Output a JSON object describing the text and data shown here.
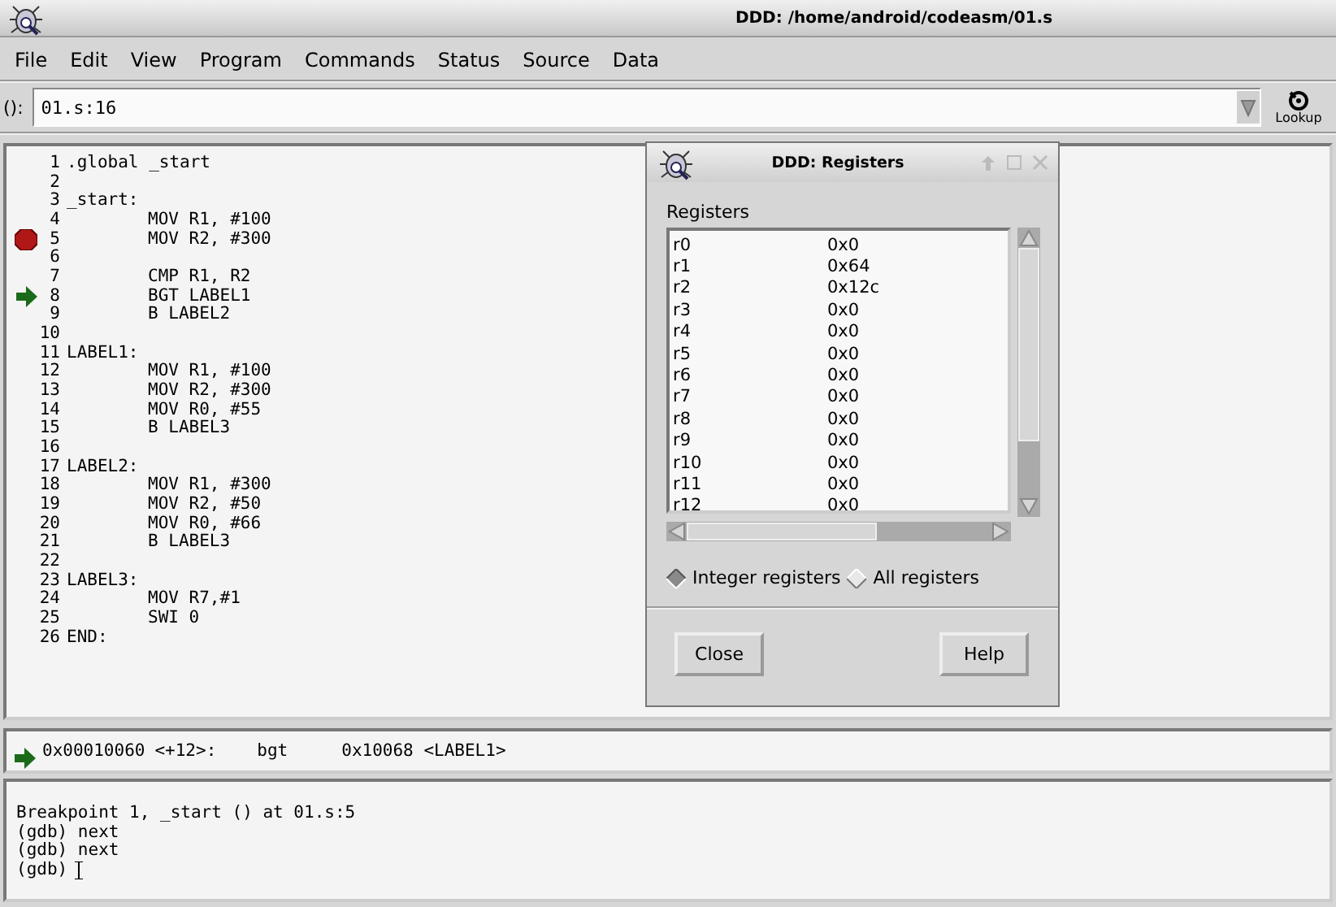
{
  "window": {
    "title": "DDD: /home/android/codeasm/01.s"
  },
  "menu": [
    "File",
    "Edit",
    "View",
    "Program",
    "Commands",
    "Status",
    "Source",
    "Data"
  ],
  "argument_field": {
    "label": "():",
    "value": "01.s:16",
    "button": "Lookup"
  },
  "source": {
    "lines": [
      {
        "number": "1",
        "kind": "label",
        "code": ".global _start",
        "breakpoint": false,
        "current": false
      },
      {
        "number": "2",
        "kind": "blank",
        "breakpoint": false,
        "current": false
      },
      {
        "number": "3",
        "kind": "label",
        "code": "_start:",
        "breakpoint": false,
        "current": false
      },
      {
        "number": "4",
        "kind": "instruction",
        "code": "MOV R1, #100",
        "breakpoint": false,
        "current": false
      },
      {
        "number": "5",
        "kind": "instruction",
        "code": "MOV R2, #300",
        "breakpoint": true,
        "current": false
      },
      {
        "number": "6",
        "kind": "blank",
        "breakpoint": false,
        "current": false
      },
      {
        "number": "7",
        "kind": "instruction",
        "code": "CMP R1, R2",
        "breakpoint": false,
        "current": false
      },
      {
        "number": "8",
        "kind": "instruction",
        "code": "BGT LABEL1",
        "breakpoint": false,
        "current": true
      },
      {
        "number": "9",
        "kind": "instruction",
        "code": "B LABEL2",
        "breakpoint": false,
        "current": false
      },
      {
        "number": "10",
        "kind": "blank",
        "breakpoint": false,
        "current": false
      },
      {
        "number": "11",
        "kind": "label",
        "code": "LABEL1:",
        "breakpoint": false,
        "current": false
      },
      {
        "number": "12",
        "kind": "instruction",
        "code": "MOV R1, #100",
        "breakpoint": false,
        "current": false
      },
      {
        "number": "13",
        "kind": "instruction",
        "code": "MOV R2, #300",
        "breakpoint": false,
        "current": false
      },
      {
        "number": "14",
        "kind": "instruction",
        "code": "MOV R0, #55",
        "breakpoint": false,
        "current": false
      },
      {
        "number": "15",
        "kind": "instruction",
        "code": "B LABEL3",
        "breakpoint": false,
        "current": false
      },
      {
        "number": "16",
        "kind": "blank",
        "breakpoint": false,
        "current": false
      },
      {
        "number": "17",
        "kind": "label",
        "code": "LABEL2:",
        "breakpoint": false,
        "current": false
      },
      {
        "number": "18",
        "kind": "instruction",
        "code": "MOV R1, #300",
        "breakpoint": false,
        "current": false
      },
      {
        "number": "19",
        "kind": "instruction",
        "code": "MOV R2, #50",
        "breakpoint": false,
        "current": false
      },
      {
        "number": "20",
        "kind": "instruction",
        "code": "MOV R0, #66",
        "breakpoint": false,
        "current": false
      },
      {
        "number": "21",
        "kind": "instruction",
        "code": "B LABEL3",
        "breakpoint": false,
        "current": false
      },
      {
        "number": "22",
        "kind": "blank",
        "breakpoint": false,
        "current": false
      },
      {
        "number": "23",
        "kind": "label",
        "code": "LABEL3:",
        "breakpoint": false,
        "current": false
      },
      {
        "number": "24",
        "kind": "instruction",
        "code": "MOV R7,#1",
        "breakpoint": false,
        "current": false
      },
      {
        "number": "25",
        "kind": "instruction",
        "code": "SWI 0",
        "breakpoint": false,
        "current": false
      },
      {
        "number": "26",
        "kind": "label",
        "code": "END:",
        "breakpoint": false,
        "current": false
      }
    ]
  },
  "machine_code": {
    "current": true,
    "address": "0x00010060",
    "offset": "<+12>:",
    "mnemonic": "bgt",
    "operand": "0x10068 <LABEL1>"
  },
  "console": {
    "lines": [
      "Breakpoint 1, _start () at 01.s:5",
      "(gdb) next",
      "(gdb) next"
    ],
    "prompt": "(gdb)"
  },
  "registers_dialog": {
    "title": "DDD: Registers",
    "list_label": "Registers",
    "registers": [
      {
        "name": "r0",
        "value": "0x0"
      },
      {
        "name": "r1",
        "value": "0x64"
      },
      {
        "name": "r2",
        "value": "0x12c"
      },
      {
        "name": "r3",
        "value": "0x0"
      },
      {
        "name": "r4",
        "value": "0x0"
      },
      {
        "name": "r5",
        "value": "0x0"
      },
      {
        "name": "r6",
        "value": "0x0"
      },
      {
        "name": "r7",
        "value": "0x0"
      },
      {
        "name": "r8",
        "value": "0x0"
      },
      {
        "name": "r9",
        "value": "0x0"
      },
      {
        "name": "r10",
        "value": "0x0"
      },
      {
        "name": "r11",
        "value": "0x0"
      },
      {
        "name": "r12",
        "value": "0x0"
      }
    ],
    "options": [
      {
        "label": "Integer registers",
        "selected": true
      },
      {
        "label": "All registers",
        "selected": false
      }
    ],
    "buttons": [
      "Close",
      "Help"
    ]
  }
}
